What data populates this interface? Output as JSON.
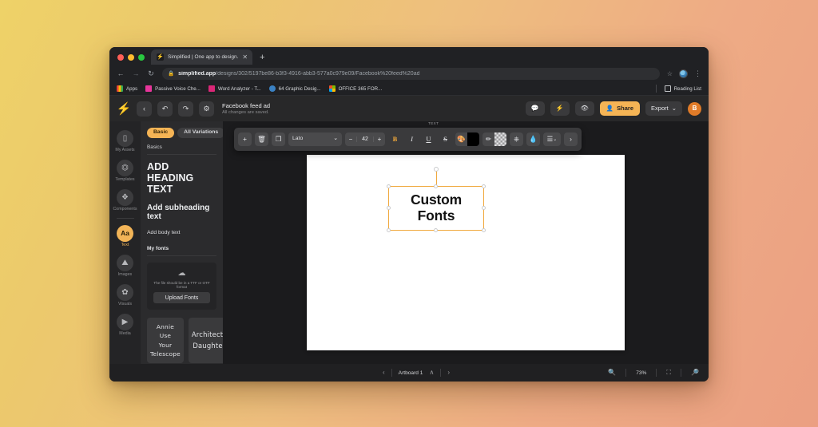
{
  "browser": {
    "tab": {
      "favicon": "simplified-logo-icon",
      "title": "Simplified | One app to design.",
      "close": "✕",
      "new_tab": "+"
    },
    "nav": {
      "back": "←",
      "forward": "→",
      "reload": "↻"
    },
    "address": {
      "lock": "🔒",
      "host": "simplified.app",
      "path": "/designs/302/5197be86-b3f3-4916-abb3-577a0c979e09/Facebook%20feed%20ad",
      "star": "☆",
      "menu": "⋮"
    },
    "bookmarks": [
      {
        "label": "Apps",
        "icon": "apps-grid-icon"
      },
      {
        "label": "Passive Voice Che...",
        "icon": "pink-square-icon"
      },
      {
        "label": "Word Analyzer - T...",
        "icon": "magenta-square-icon"
      },
      {
        "label": "64 Graphic Desig...",
        "icon": "blue-circle-icon"
      },
      {
        "label": "OFFICE 365 FOR...",
        "icon": "microsoft-icon"
      }
    ],
    "reading_list": "Reading List"
  },
  "app_header": {
    "logo": "simplified-bolt-logo",
    "back": "‹",
    "undo": "↶",
    "redo": "↷",
    "settings": "⚙",
    "doc_title": "Facebook feed ad",
    "doc_status": "All changes are saved.",
    "comment_icon": "comment-bubble-icon",
    "bolt_icon": "lightning-bolt-icon",
    "preview_icon": "eye-icon",
    "share_label": "Share",
    "share_icon": "person-plus-icon",
    "export_label": "Export",
    "export_caret": "⌄",
    "avatar_initial": "B"
  },
  "rail": {
    "items": [
      {
        "label": "My Assets",
        "icon": "folder-icon",
        "glyph": "▬",
        "active": false
      },
      {
        "label": "Templates",
        "icon": "templates-icon",
        "glyph": "⬚",
        "active": false
      },
      {
        "label": "Components",
        "icon": "components-icon",
        "glyph": "❖",
        "active": false
      },
      {
        "label": "Text",
        "icon": "text-aa-icon",
        "glyph": "Aa",
        "active": true
      },
      {
        "label": "Images",
        "icon": "image-icon",
        "glyph": "⛰",
        "active": false
      },
      {
        "label": "Visuals",
        "icon": "visuals-icon",
        "glyph": "✿",
        "active": false
      },
      {
        "label": "Media",
        "icon": "play-icon",
        "glyph": "▶",
        "active": false
      }
    ]
  },
  "panel": {
    "tabs": [
      {
        "label": "Basic",
        "active": true
      },
      {
        "label": "All Variations",
        "active": false
      }
    ],
    "section_label": "Basics",
    "presets": {
      "heading": "ADD HEADING TEXT",
      "subheading": "Add subheading text",
      "body": "Add body text"
    },
    "my_fonts_label": "My fonts",
    "upload": {
      "icon": "cloud-upload-icon",
      "hint": "The file should be in a TTF or OTF format",
      "button": "Upload Fonts"
    },
    "fonts": [
      {
        "name": "Annie Use Your Telescope",
        "line1": "Annie Use",
        "line2": "Your Telescope"
      },
      {
        "name": "Architects Daughter",
        "line1": "Architects",
        "line2": "Daughter"
      }
    ]
  },
  "text_toolbar": {
    "section_label": "TEXT",
    "add": "+",
    "delete_icon": "trash-icon",
    "duplicate_icon": "copy-icon",
    "font_family": "Lato",
    "font_caret": "⌄",
    "size_minus": "−",
    "font_size": "42",
    "size_plus": "+",
    "bold": "B",
    "italic": "I",
    "underline": "U",
    "strikethrough": "S",
    "fill_icon": "palette-icon",
    "fill_color": "#000000",
    "stroke_icon": "pen-icon",
    "stroke_color": "transparent",
    "bucket_icon": "paint-bucket-icon",
    "eyedropper_icon": "eyedropper-icon",
    "layers_icon": "layers-icon",
    "layers_caret": "⌄",
    "more": "›"
  },
  "canvas": {
    "text_line1": "Custom",
    "text_line2": "Fonts",
    "selection_color": "#f0a93e"
  },
  "bottombar": {
    "prev": "‹",
    "artboard_label": "Artboard 1",
    "collapse": "∧",
    "next": "›",
    "zoom_out_icon": "zoom-out-icon",
    "zoom_level": "73%",
    "fit_icon": "fit-screen-icon",
    "zoom_in_icon": "zoom-in-icon"
  }
}
